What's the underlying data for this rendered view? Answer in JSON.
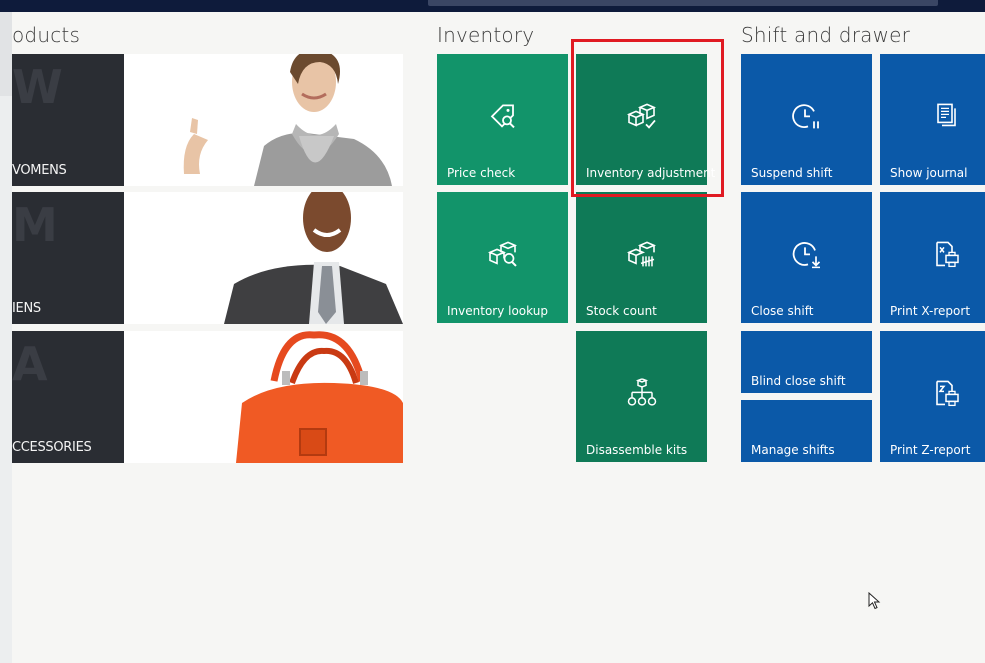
{
  "sections": {
    "products": {
      "title": "oducts",
      "tiles": [
        {
          "label": "VOMENS",
          "letter": "W"
        },
        {
          "label": "IENS",
          "letter": "M"
        },
        {
          "label": "CCESSORIES",
          "letter": "A"
        }
      ]
    },
    "inventory": {
      "title": "Inventory",
      "tiles": [
        {
          "label": "Price check",
          "icon": "price-tag-search-icon"
        },
        {
          "label": "Inventory adjustment",
          "icon": "boxes-check-icon"
        },
        {
          "label": "Inventory lookup",
          "icon": "boxes-search-icon"
        },
        {
          "label": "Stock count",
          "icon": "boxes-count-icon"
        },
        {
          "label": "Disassemble kits",
          "icon": "hierarchy-icon"
        }
      ]
    },
    "shift": {
      "title": "Shift and drawer",
      "tiles": [
        {
          "label": "Suspend shift",
          "icon": "clock-pause-icon"
        },
        {
          "label": "Show journal",
          "icon": "journal-icon"
        },
        {
          "label": "Close shift",
          "icon": "clock-down-icon"
        },
        {
          "label": "Print X-report",
          "icon": "print-x-report-icon"
        },
        {
          "label": "Blind close shift"
        },
        {
          "label": "Manage shifts"
        },
        {
          "label": "Print Z-report",
          "icon": "print-z-report-icon"
        }
      ]
    }
  },
  "colors": {
    "inventory_green_light": "#12946a",
    "inventory_green_dark": "#0f7a57",
    "shift_blue": "#0b59a8",
    "highlight_red": "#e01a22"
  }
}
